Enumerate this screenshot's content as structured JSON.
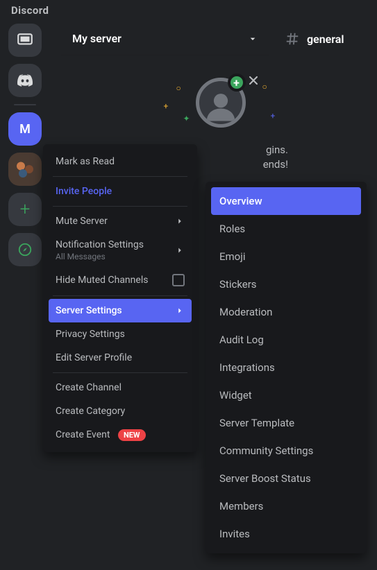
{
  "brand": "Discord",
  "rail": {
    "active_initial": "M",
    "add_symbol": "+"
  },
  "header": {
    "server_name": "My server",
    "channel_name": "general"
  },
  "welcome": {
    "line1_tail": "gins.",
    "line2_tail": "ends!"
  },
  "context_menu": {
    "mark_as_read": "Mark as Read",
    "invite_people": "Invite People",
    "mute_server": "Mute Server",
    "notification_settings": "Notification Settings",
    "notification_sub": "All Messages",
    "hide_muted": "Hide Muted Channels",
    "server_settings": "Server Settings",
    "privacy_settings": "Privacy Settings",
    "edit_server_profile": "Edit Server Profile",
    "create_channel": "Create Channel",
    "create_category": "Create Category",
    "create_event": "Create Event",
    "new_badge": "NEW"
  },
  "sub_menu": {
    "overview": "Overview",
    "roles": "Roles",
    "emoji": "Emoji",
    "stickers": "Stickers",
    "moderation": "Moderation",
    "audit_log": "Audit Log",
    "integrations": "Integrations",
    "widget": "Widget",
    "server_template": "Server Template",
    "community_settings": "Community Settings",
    "server_boost_status": "Server Boost Status",
    "members": "Members",
    "invites": "Invites"
  }
}
